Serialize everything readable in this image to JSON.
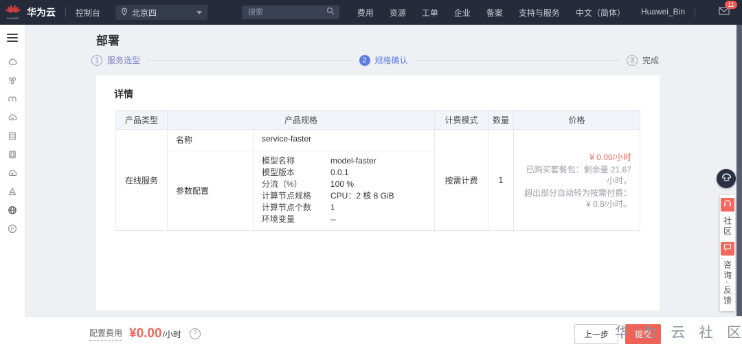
{
  "colors": {
    "topbar_bg": "#252b3a",
    "accent_blue": "#5e7ce0",
    "brand_red": "#d43d3f",
    "price_red": "#f2665c",
    "submit_red": "#ee6257",
    "float_red": "#f2695f"
  },
  "topbar": {
    "brand": "华为云",
    "logo_sub": "HUAWEI",
    "console_label": "控制台",
    "region": "北京四",
    "search_placeholder": "搜索",
    "menu_items": [
      "费用",
      "资源",
      "工单",
      "企业",
      "备案",
      "支持与服务",
      "中文（简体）",
      "Huawei_Bin"
    ],
    "mail_badge": "11"
  },
  "sidebar": {
    "icons": [
      "menu",
      "ai-cloud",
      "cluster",
      "gateway",
      "cloud-service",
      "server",
      "container",
      "cloud-eye",
      "lab",
      "globe",
      "parking"
    ]
  },
  "page": {
    "title": "部署"
  },
  "wizard": {
    "steps": [
      {
        "num": "1",
        "label": "服务选型",
        "state": "done"
      },
      {
        "num": "2",
        "label": "规格确认",
        "state": "active"
      },
      {
        "num": "3",
        "label": "完成",
        "state": "pending"
      }
    ]
  },
  "detail": {
    "heading": "详情",
    "table": {
      "headers": [
        "产品类型",
        "产品规格",
        "计费模式",
        "数量",
        "价格"
      ],
      "row": {
        "product_type": "在线服务",
        "name_label": "名称",
        "name_value": "service-faster",
        "config_label": "参数配置",
        "params": [
          {
            "label": "模型名称",
            "value": "model-faster"
          },
          {
            "label": "模型版本",
            "value": "0.0.1"
          },
          {
            "label": "分流（%）",
            "value": "100 %"
          },
          {
            "label": "计算节点规格",
            "value": "CPU：2 核 8 GiB"
          },
          {
            "label": "计算节点个数",
            "value": "1"
          },
          {
            "label": "环境变量",
            "value": "--"
          }
        ],
        "billing_mode": "按需计费",
        "quantity": "1",
        "price": "¥ 0.00/小时",
        "price_note_line1": "已购买套餐包：剩余量 21.67 小时，",
        "price_note_line2": "超出部分自动转为按需付费：¥ 0.8/小时。"
      }
    }
  },
  "footer": {
    "cost_label": "配置费用",
    "cost_value": "¥0.00",
    "cost_unit": "/小时",
    "help_glyph": "?",
    "prev_button": "上一步",
    "submit_button": "提交"
  },
  "floating": {
    "community_label": "社区",
    "feedback_label": "咨询·反馈"
  },
  "watermark": "华 为 云 社 区"
}
